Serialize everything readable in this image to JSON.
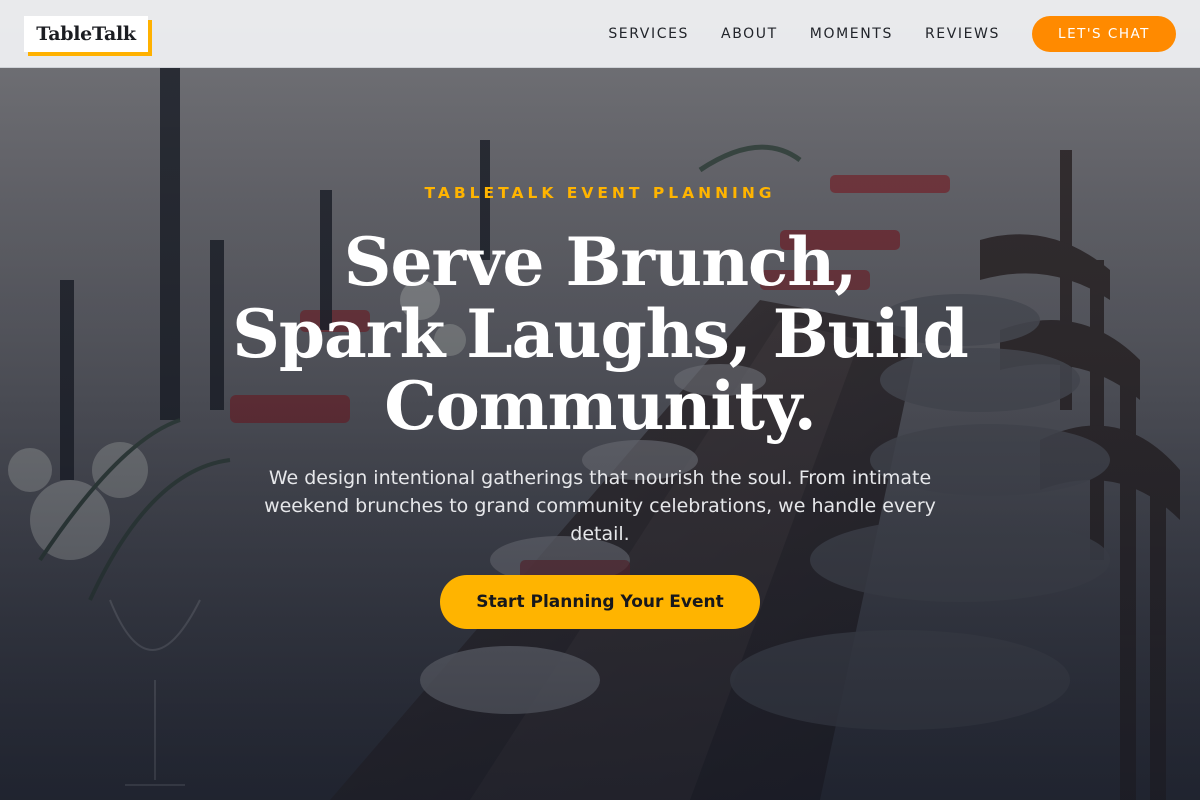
{
  "brand": {
    "logo_text": "TableTalk"
  },
  "nav": {
    "items": [
      {
        "label": "SERVICES"
      },
      {
        "label": "ABOUT"
      },
      {
        "label": "MOMENTS"
      },
      {
        "label": "REVIEWS"
      }
    ],
    "cta_label": "LET'S CHAT"
  },
  "hero": {
    "eyebrow": "TABLETALK EVENT PLANNING",
    "headline": "Serve Brunch, Spark Laughs, Build Community.",
    "subtext": "We design intentional gatherings that nourish the soul. From intimate weekend brunches to grand community celebrations, we handle every detail.",
    "cta_label": "Start Planning Your Event"
  },
  "colors": {
    "accent_yellow": "#ffb400",
    "accent_orange": "#ff8a00",
    "header_bg": "#ecedef",
    "text_dark": "#22252b"
  }
}
